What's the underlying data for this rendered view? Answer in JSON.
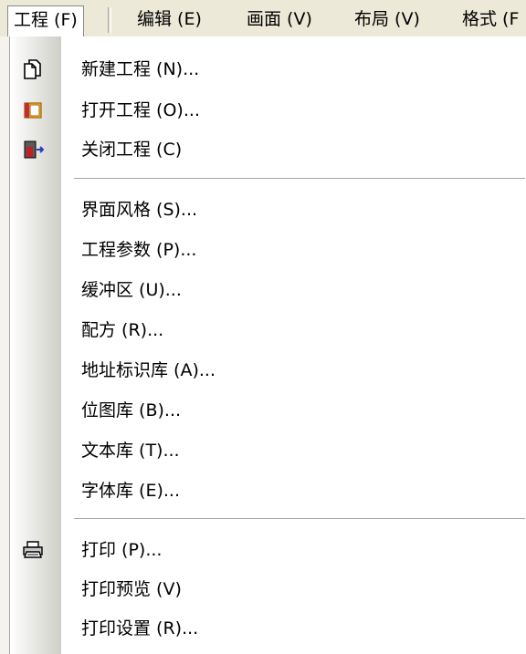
{
  "menubar": {
    "items": [
      "工程 (F)",
      "编辑 (E)",
      "画面 (V)",
      "布局 (V)",
      "格式 (F"
    ]
  },
  "menu": {
    "group1": [
      {
        "label": "新建工程 (N)...",
        "icon": "new-project-icon"
      },
      {
        "label": "打开工程 (O)...",
        "icon": "open-project-icon"
      },
      {
        "label": "关闭工程 (C)",
        "icon": "close-project-icon"
      }
    ],
    "group2": [
      {
        "label": "界面风格 (S)..."
      },
      {
        "label": "工程参数 (P)..."
      },
      {
        "label": "缓冲区 (U)..."
      },
      {
        "label": "配方 (R)..."
      },
      {
        "label": "地址标识库 (A)..."
      },
      {
        "label": "位图库 (B)..."
      },
      {
        "label": "文本库 (T)..."
      },
      {
        "label": "字体库 (E)..."
      }
    ],
    "group3": [
      {
        "label": "打印 (P)...",
        "icon": "printer-icon"
      },
      {
        "label": "打印预览 (V)"
      },
      {
        "label": "打印设置 (R)..."
      }
    ]
  },
  "colors": {
    "menubar_bg": "#ece9d8",
    "gutter_end": "#cfcfc8"
  }
}
